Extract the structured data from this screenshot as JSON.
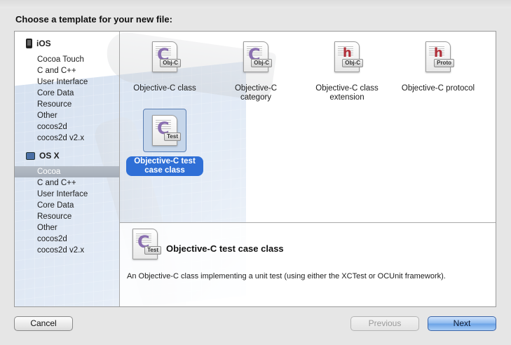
{
  "dialog": {
    "heading": "Choose a template for your new file:"
  },
  "sidebar": {
    "groups": [
      {
        "title": "iOS",
        "icon": "iphone-icon",
        "items": [
          "Cocoa Touch",
          "C and C++",
          "User Interface",
          "Core Data",
          "Resource",
          "Other",
          "cocos2d",
          "cocos2d v2.x"
        ]
      },
      {
        "title": "OS X",
        "icon": "mac-icon",
        "items": [
          "Cocoa",
          "C and C++",
          "User Interface",
          "Core Data",
          "Resource",
          "Other",
          "cocos2d",
          "cocos2d v2.x"
        ]
      }
    ],
    "selected": "OS X / Cocoa"
  },
  "templates": [
    {
      "label": "Objective-C class",
      "badge": "Obj-C",
      "glyph": "C"
    },
    {
      "label": "Objective-C category",
      "badge": "Obj-C",
      "glyph": "C"
    },
    {
      "label": "Objective-C class extension",
      "badge": "Obj-C",
      "glyph": "h"
    },
    {
      "label": "Objective-C protocol",
      "badge": "Proto",
      "glyph": "h"
    },
    {
      "label": "Objective-C test case class",
      "badge": "Test",
      "glyph": "C"
    }
  ],
  "selected_template": "Objective-C test case class",
  "description": {
    "title": "Objective-C test case class",
    "badge": "Test",
    "glyph": "C",
    "text": "An Objective-C class implementing a unit test (using either the XCTest or OCUnit framework)."
  },
  "buttons": {
    "cancel": "Cancel",
    "previous": "Previous",
    "next": "Next"
  }
}
